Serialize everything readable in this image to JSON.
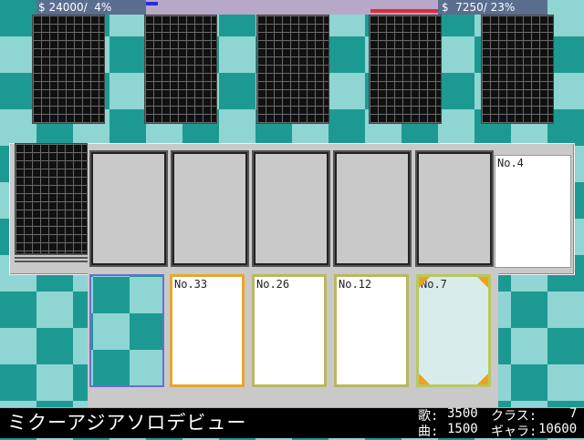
{
  "status": {
    "left_money": "$ 24000/  4%",
    "right_money": "$  7250/ 23%",
    "left_fill_percent": 4,
    "right_fill_percent": 23,
    "left_color": "#2b2be0",
    "right_color": "#e02a3a"
  },
  "board": {
    "opponent_cards": 5,
    "field_card_label": "No.4"
  },
  "hand": [
    {
      "label": ""
    },
    {
      "label": "No.33"
    },
    {
      "label": "No.26"
    },
    {
      "label": "No.12"
    },
    {
      "label": "No.7"
    }
  ],
  "footer": {
    "song_title": "ミクーアジアソロデビュー",
    "uta_label": "歌:",
    "uta_value": "3500",
    "class_label": "クラス:",
    "class_value": "7",
    "kyoku_label": "曲:",
    "kyoku_value": "1500",
    "gyara_label": "ギャラ:",
    "gyara_value": "10600"
  },
  "colors": {
    "background_dark": "#1c9a92",
    "background_light": "#8fd5d3",
    "card_border_selected": "#e6a632"
  }
}
